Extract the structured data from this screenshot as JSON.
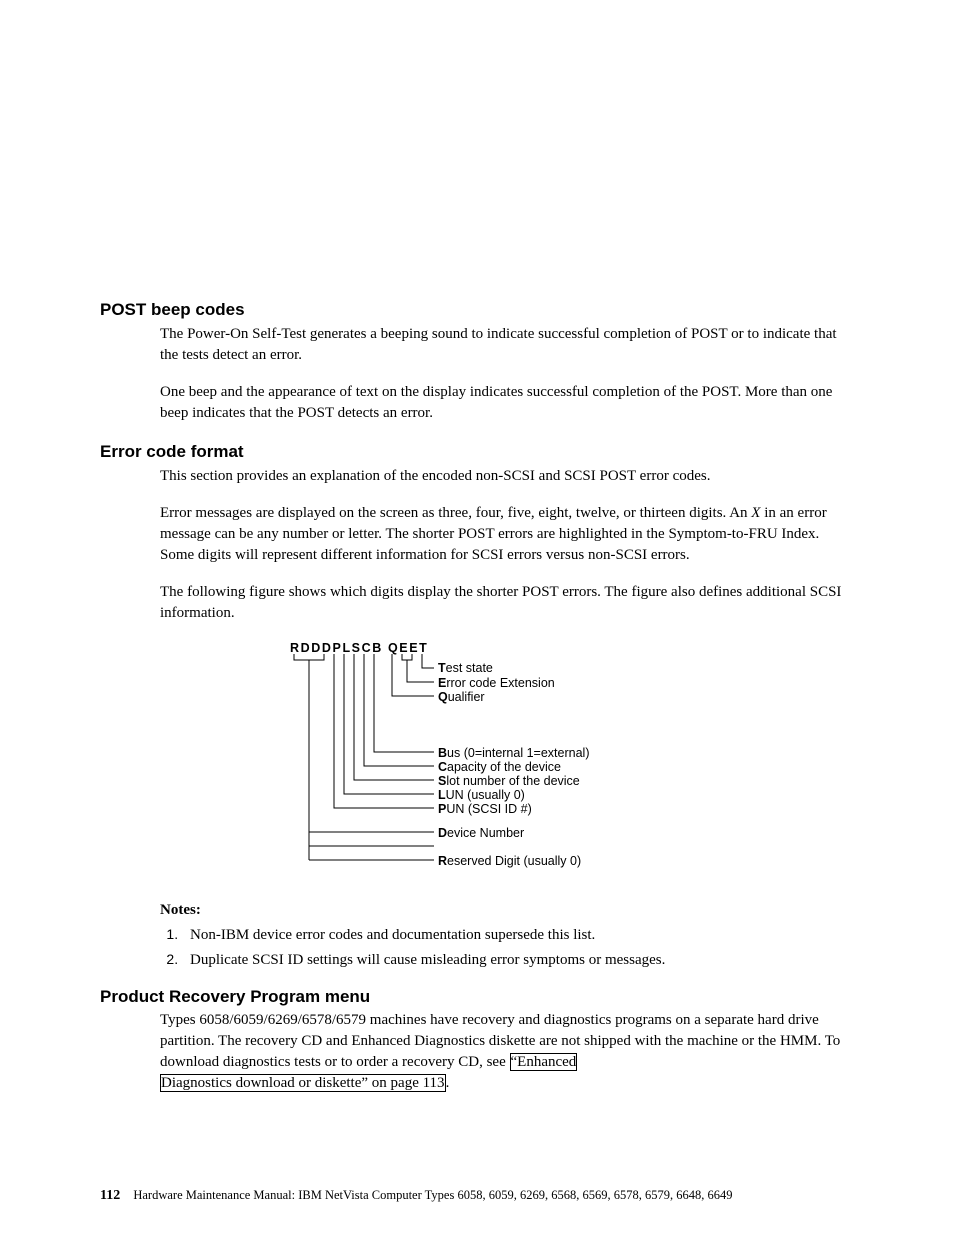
{
  "sections": {
    "post": {
      "heading": "POST beep codes",
      "p1": "The Power-On Self-Test generates a beeping sound to indicate successful completion of POST or to indicate that the tests detect an error.",
      "p2": "One beep and the appearance of text on the display indicates successful completion of the POST. More than one beep indicates that the POST detects an error."
    },
    "error": {
      "heading": "Error code format",
      "p1": "This section provides an explanation of the encoded non-SCSI and SCSI POST error codes.",
      "p2_pre": "Error messages are displayed on the screen as three, four, five, eight, twelve, or thirteen digits. An ",
      "p2_italic": "X",
      "p2_post": " in an error message can be any number or letter. The shorter POST errors are highlighted in the Symptom-to-FRU Index. Some digits will represent different information for SCSI errors versus non-SCSI errors.",
      "p3": "The following figure shows which digits display the shorter POST errors. The figure also defines additional SCSI information."
    },
    "notes": {
      "heading": "Notes:",
      "n1": "Non-IBM device error codes and documentation supersede this list.",
      "n2": "Duplicate SCSI ID settings will cause misleading error symptoms or messages."
    },
    "recovery": {
      "heading": "Product Recovery Program menu",
      "p1_pre": "Types 6058/6059/6269/6578/6579 machines have recovery and diagnostics programs on a separate hard drive partition. The recovery CD and Enhanced Diagnostics diskette are not shipped with the machine or the HMM. To download diagnostics tests or to order a recovery CD, see ",
      "link_a": "“Enhanced",
      "link_b": "Diagnostics download or diskette” on page 113",
      "p1_post": "."
    }
  },
  "chart_data": {
    "type": "diagram",
    "title": "RDDDPLSCB QEET",
    "header": "RDDDPLSCB QEET",
    "labels": [
      {
        "letter": "T",
        "rest": "est state"
      },
      {
        "letter": "E",
        "rest": "rror code Extension"
      },
      {
        "letter": "Q",
        "rest": "ualifier"
      },
      {
        "letter": "B",
        "rest": "us (0=internal  1=external)"
      },
      {
        "letter": "C",
        "rest": "apacity of the device"
      },
      {
        "letter": "S",
        "rest": "lot number of the device"
      },
      {
        "letter": "L",
        "rest": "UN (usually 0)"
      },
      {
        "letter": "P",
        "rest": "UN (SCSI ID #)"
      },
      {
        "letter": "D",
        "rest": "evice Number"
      },
      {
        "letter": "R",
        "rest": "eserved Digit (usually 0)"
      }
    ]
  },
  "footer": {
    "page": "112",
    "text": "Hardware Maintenance Manual: IBM NetVista Computer Types 6058, 6059, 6269, 6568, 6569, 6578, 6579, 6648, 6649"
  }
}
